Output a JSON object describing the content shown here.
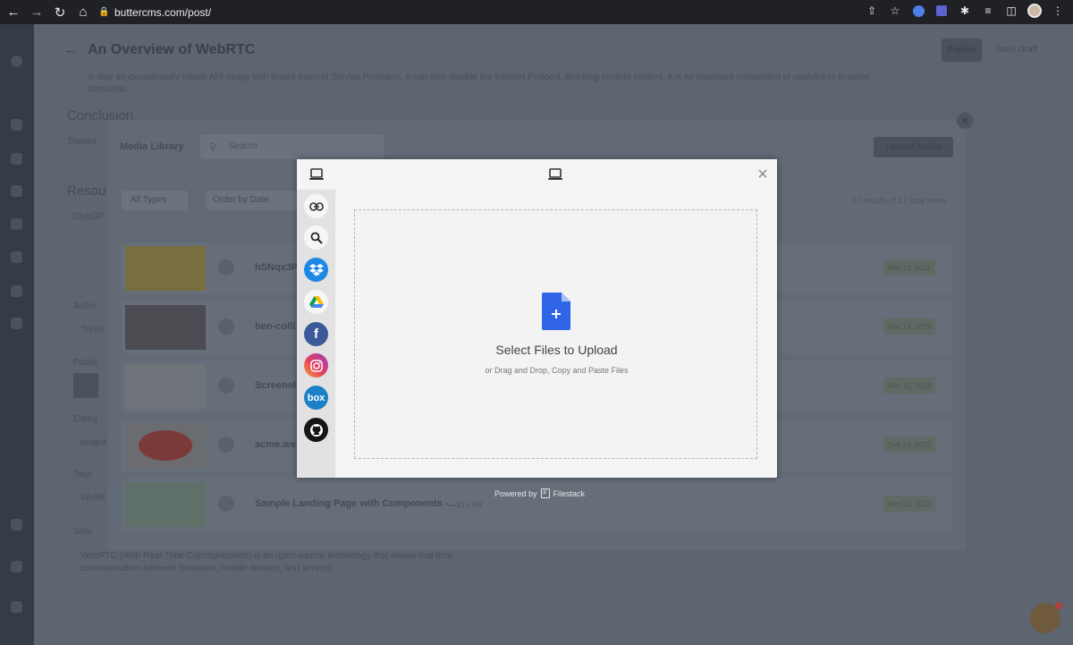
{
  "browser": {
    "url": "buttercms.com/post/"
  },
  "page": {
    "title": "An Overview of WebRTC",
    "publish_label": "Publish",
    "save_draft_label": "Save Draft",
    "bg_paragraph": "is also an exceptionally robust API usage with tested Internet Service Providers. It can also disable the Internet Protocol. Blocking content content. It is an important component of usefulness in some scenarios.",
    "conclusion_heading": "Conclusion",
    "conclusion_text": "Thanks",
    "resources_heading": "Resou",
    "resources_item": "- ChatGP",
    "author_label": "Autho",
    "author_value": "Trevo",
    "published_label": "Publis",
    "category_label": "Categ",
    "category_value": "progra",
    "tags_label": "Tags",
    "tags_value": "WebR",
    "summary_label": "Sum",
    "summary_text": "WebRTC (Web Real-Time Communication) is an open-source technology that allows real-time communication between browsers, mobile devices, and servers."
  },
  "media_library": {
    "title": "Media Library",
    "search_placeholder": "Search",
    "upload_label": "Upload Media",
    "filter_label": "All Types",
    "order_label": "Order by Date",
    "results_text": "17 results of 17 total items",
    "rows": [
      {
        "name": "hSNqx3P",
        "date": "Mar 13, 2023"
      },
      {
        "name": "ben-colli",
        "date": "Mar 13, 2023"
      },
      {
        "name": "Screensh",
        "date": "Dec 31, 2022"
      },
      {
        "name": "acme.we",
        "date": "Dec 23, 2022"
      },
      {
        "name": "Sample Landing Page with Components -...",
        "size": "81.4 KB",
        "date": "Dec 23, 2022"
      }
    ]
  },
  "picker": {
    "sources": [
      "link-icon",
      "search-icon",
      "dropbox-icon",
      "google-drive-icon",
      "facebook-icon",
      "instagram-icon",
      "box-icon",
      "github-icon"
    ],
    "box_text": "box",
    "facebook_text": "f",
    "drop_title": "Select Files to Upload",
    "drop_subtitle": "or Drag and Drop, Copy and Paste Files",
    "powered_prefix": "Powered by",
    "powered_brand": "Filestack"
  }
}
